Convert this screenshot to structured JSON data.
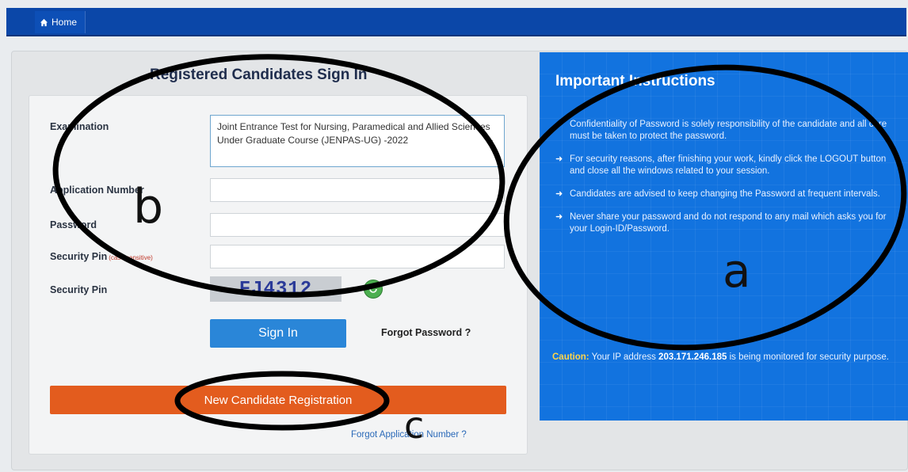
{
  "nav": {
    "home_label": "Home"
  },
  "signin": {
    "title": "Registered Candidates Sign In",
    "labels": {
      "examination": "Examination",
      "application_number": "Application Number",
      "password": "Password",
      "security_pin_input": "Security Pin",
      "security_pin_hint": "(case sensitive)",
      "security_pin": "Security Pin"
    },
    "examination_value": "Joint Entrance Test for Nursing, Paramedical and Allied Sciences Under Graduate Course (JENPAS-UG) -2022",
    "application_number_value": "",
    "password_value": "",
    "security_pin_value": "",
    "captcha_text": "FJ4312",
    "signin_label": "Sign In",
    "forgot_password_label": "Forgot Password ?",
    "new_registration_label": "New Candidate Registration",
    "forgot_application_label": "Forgot Application Number ?"
  },
  "instructions": {
    "title": "Important Instructions",
    "items": [
      "Confidentiality of Password is solely responsibility of the candidate and all care must be taken to protect the password.",
      "For security reasons, after finishing your work, kindly click the LOGOUT button and close all the windows related to your session.",
      "Candidates are advised to keep changing the Password at frequent intervals.",
      "Never share your password and do not respond to any mail which asks you for your Login-ID/Password."
    ],
    "caution_label": "Caution:",
    "caution_pre": "Your IP address",
    "caution_ip": "203.171.246.185",
    "caution_post": "is being monitored for security purpose."
  },
  "annotations": {
    "a": "a",
    "b": "b",
    "c": "c"
  },
  "colors": {
    "topbar": "#0b47a8",
    "signin_button": "#2a86d8",
    "registration_button": "#e35c1e",
    "instructions_panel": "#1273df",
    "caution_label": "#ffd54a"
  }
}
